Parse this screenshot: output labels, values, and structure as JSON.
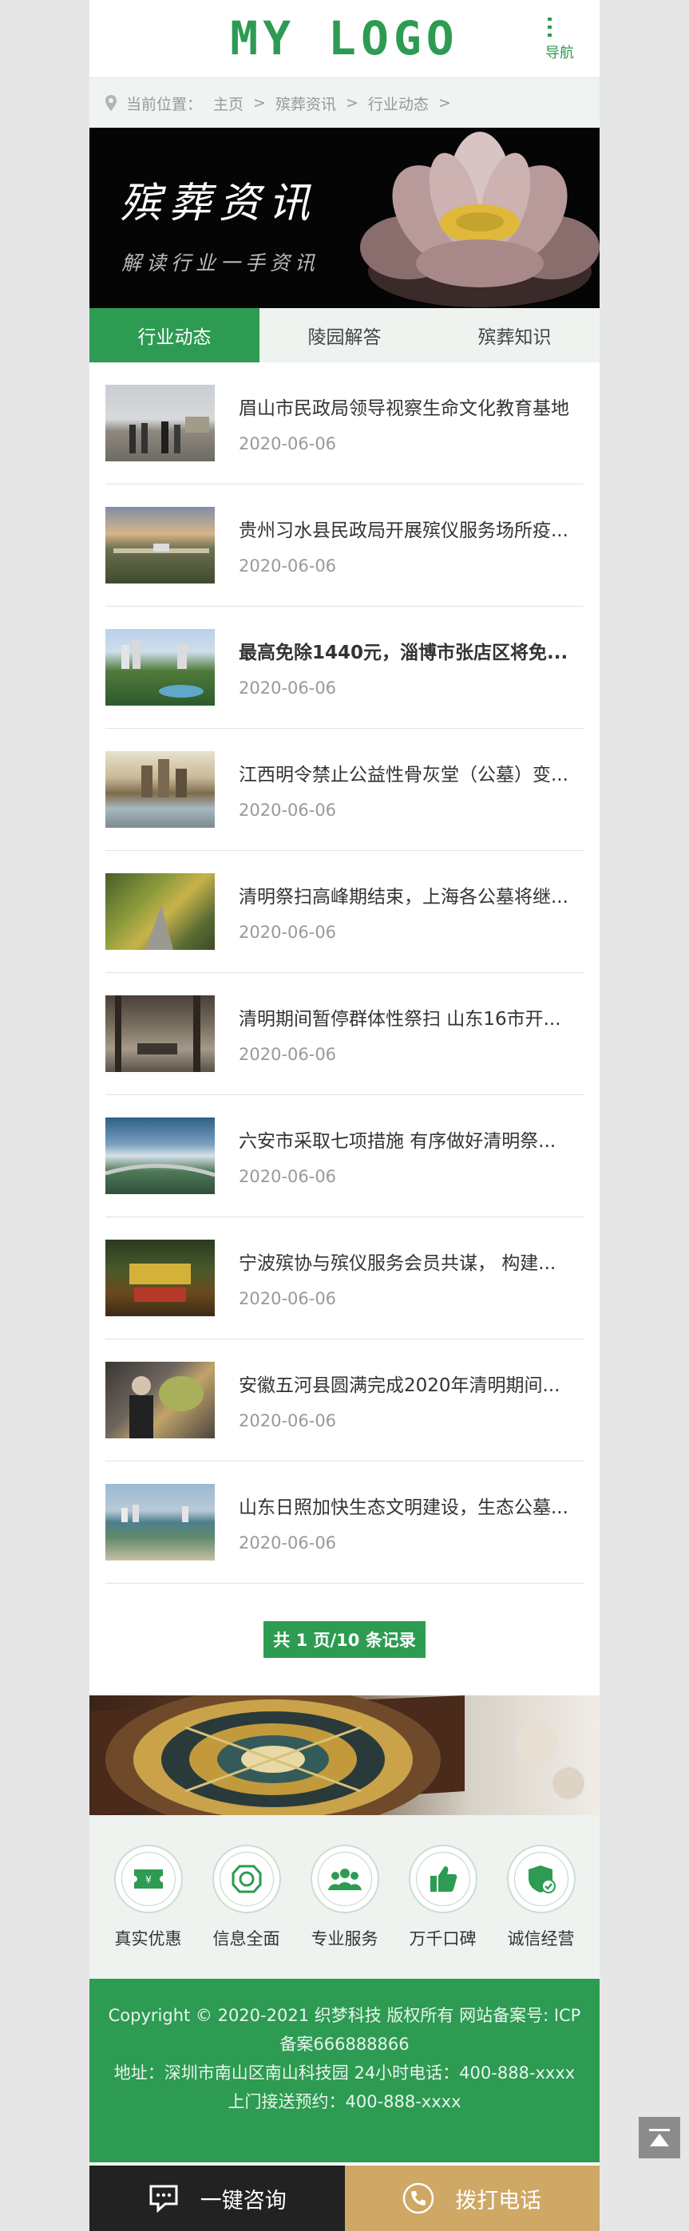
{
  "header": {
    "logo": "MY LOGO",
    "nav_label": "导航"
  },
  "breadcrumb": {
    "prefix": "当前位置：",
    "items": [
      "主页",
      "殡葬资讯",
      "行业动态"
    ]
  },
  "banner": {
    "title": "殡葬资讯",
    "subtitle": "解读行业一手资讯"
  },
  "tabs": [
    {
      "label": "行业动态"
    },
    {
      "label": "陵园解答"
    },
    {
      "label": "殡葬知识"
    }
  ],
  "articles": [
    {
      "title": "眉山市民政局领导视察生命文化教育基地",
      "date": "2020-06-06"
    },
    {
      "title": "贵州习水县民政局开展殡仪服务场所疫...",
      "date": "2020-06-06"
    },
    {
      "title": "最高免除1440元，淄博市张店区将免...",
      "date": "2020-06-06"
    },
    {
      "title": "江西明令禁止公益性骨灰堂（公墓）变...",
      "date": "2020-06-06"
    },
    {
      "title": "清明祭扫高峰期结束，上海各公墓将继...",
      "date": "2020-06-06"
    },
    {
      "title": "清明期间暂停群体性祭扫 山东16市开...",
      "date": "2020-06-06"
    },
    {
      "title": "六安市采取七项措施 有序做好清明祭...",
      "date": "2020-06-06"
    },
    {
      "title": "宁波殡协与殡仪服务会员共谋， 构建...",
      "date": "2020-06-06"
    },
    {
      "title": "安徽五河县圆满完成2020年清明期间...",
      "date": "2020-06-06"
    },
    {
      "title": "山东日照加快生态文明建设，生态公墓...",
      "date": "2020-06-06"
    }
  ],
  "pager": {
    "text": "共 1 页/10 条记录"
  },
  "features": [
    {
      "label": "真实优惠",
      "icon": "ticket-icon"
    },
    {
      "label": "信息全面",
      "icon": "info-icon"
    },
    {
      "label": "专业服务",
      "icon": "team-icon"
    },
    {
      "label": "万千口碑",
      "icon": "thumbs-up-icon"
    },
    {
      "label": "诚信经营",
      "icon": "shield-check-icon"
    }
  ],
  "footer": {
    "line1": "Copyright © 2020-2021 织梦科技 版权所有 网站备案号: ICP备案666888866",
    "line2": "地址：深圳市南山区南山科技园   24小时电话：400-888-xxxx",
    "line3": "上门接送预约：400-888-xxxx"
  },
  "bottom_bar": {
    "consult": "一键咨询",
    "call": "拨打电话"
  },
  "colors": {
    "accent": "#2d9b52",
    "gold": "#cfa866",
    "dark": "#222222"
  }
}
